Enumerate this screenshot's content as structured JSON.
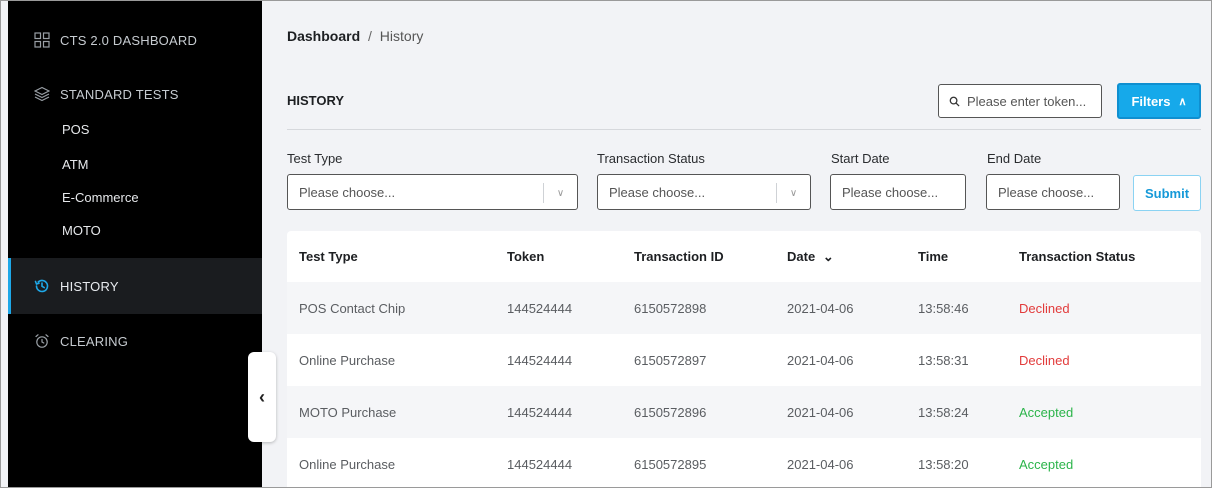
{
  "sidebar": {
    "dashboard": "CTS 2.0 DASHBOARD",
    "standard_tests": "STANDARD TESTS",
    "sub_items": [
      "POS",
      "ATM",
      "E-Commerce",
      "MOTO"
    ],
    "history": "HISTORY",
    "clearing": "CLEARING"
  },
  "breadcrumb": {
    "root": "Dashboard",
    "separator": "/",
    "current": "History"
  },
  "card": {
    "title": "HISTORY"
  },
  "search": {
    "placeholder": "Please enter token..."
  },
  "filters_button": {
    "label": "Filters"
  },
  "filter_form": {
    "test_type_label": "Test Type",
    "test_type_value": "Please choose...",
    "status_label": "Transaction Status",
    "status_value": "Please choose...",
    "start_date_label": "Start Date",
    "start_date_value": "Please choose...",
    "end_date_label": "End Date",
    "end_date_value": "Please choose...",
    "submit_label": "Submit"
  },
  "table": {
    "headers": [
      "Test Type",
      "Token",
      "Transaction ID",
      "Date",
      "Time",
      "Transaction Status"
    ],
    "rows": [
      {
        "test_type": "POS Contact Chip",
        "token": "144524444",
        "transaction_id": "6150572898",
        "date": "2021-04-06",
        "time": "13:58:46",
        "status": "Declined"
      },
      {
        "test_type": "Online Purchase",
        "token": "144524444",
        "transaction_id": "6150572897",
        "date": "2021-04-06",
        "time": "13:58:31",
        "status": "Declined"
      },
      {
        "test_type": "MOTO Purchase",
        "token": "144524444",
        "transaction_id": "6150572896",
        "date": "2021-04-06",
        "time": "13:58:24",
        "status": "Accepted"
      },
      {
        "test_type": "Online Purchase",
        "token": "144524444",
        "transaction_id": "6150572895",
        "date": "2021-04-06",
        "time": "13:58:20",
        "status": "Accepted"
      }
    ]
  },
  "colors": {
    "accent": "#16a9ea",
    "declined": "#e23b3b",
    "accepted": "#2bb44a",
    "sidebar_bg": "#000000"
  },
  "icons": {
    "dashboard": "grid-icon",
    "standard_tests": "layers-icon",
    "history": "history-icon",
    "clearing": "alarm-clock-icon",
    "search": "search-icon",
    "collapse": "chevron-left-icon"
  }
}
